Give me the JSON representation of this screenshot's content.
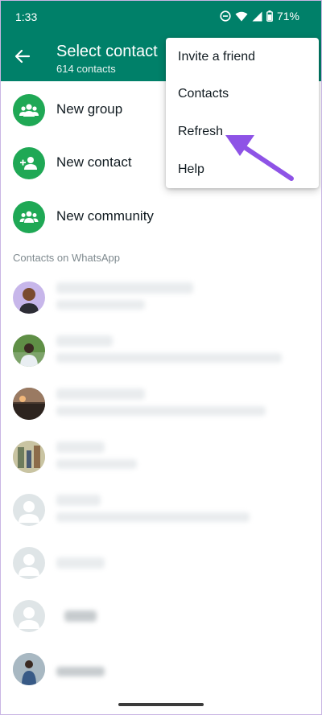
{
  "status_bar": {
    "time": "1:33",
    "battery": "71%"
  },
  "app_bar": {
    "title": "Select contact",
    "subtitle": "614 contacts"
  },
  "actions": [
    {
      "label": "New group"
    },
    {
      "label": "New contact"
    },
    {
      "label": "New community"
    }
  ],
  "section_header": "Contacts on WhatsApp",
  "menu": {
    "items": [
      {
        "label": "Invite a friend"
      },
      {
        "label": "Contacts"
      },
      {
        "label": "Refresh"
      },
      {
        "label": "Help"
      }
    ]
  },
  "contacts": [
    {
      "avatar": "cartoon"
    },
    {
      "avatar": "photo"
    },
    {
      "avatar": "photo"
    },
    {
      "avatar": "photo"
    },
    {
      "avatar": "default"
    },
    {
      "avatar": "default"
    },
    {
      "avatar": "default"
    },
    {
      "avatar": "photo"
    }
  ],
  "colors": {
    "header": "#008069",
    "accent": "#1fa855",
    "arrow": "#8e53e6"
  }
}
